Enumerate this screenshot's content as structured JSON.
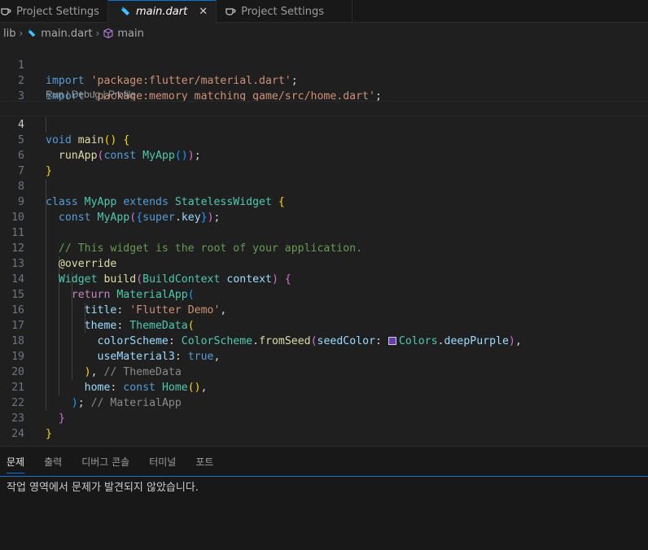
{
  "tabs": [
    {
      "label": "Project Settings",
      "active": false,
      "icon": "cup-icon"
    },
    {
      "label": "main.dart",
      "active": true,
      "icon": "dart-icon",
      "close": "✕"
    },
    {
      "label": "Project Settings",
      "active": false,
      "icon": "cup-icon"
    }
  ],
  "breadcrumb": {
    "folder": "lib",
    "file": "main.dart",
    "symbol": "main"
  },
  "codelens": "Run | Debug | Profile",
  "lines": {
    "n1": "1",
    "n2": "2",
    "n3": "3",
    "n4": "4",
    "n5": "5",
    "n6": "6",
    "n7": "7",
    "n8": "8",
    "n9": "9",
    "n10": "10",
    "n11": "11",
    "n12": "12",
    "n13": "13",
    "n14": "14",
    "n15": "15",
    "n16": "16",
    "n17": "17",
    "n18": "18",
    "n19": "19",
    "n20": "20",
    "n21": "21",
    "n22": "22",
    "n23": "23",
    "n24": "24"
  },
  "code": {
    "import": "import",
    "pkg_material": "'package:flutter/material.dart'",
    "pkg_home": "'package:memory_matching_game/src/home.dart'",
    "semi": ";",
    "void": "void",
    "main": "main",
    "runApp": "runApp",
    "const": "const",
    "MyApp": "MyApp",
    "class": "class",
    "extends": "extends",
    "StatelessWidget": "StatelessWidget",
    "super": "super",
    "key": "key",
    "comment_root": "// This widget is the root of your application.",
    "override": "@override",
    "Widget": "Widget",
    "build": "build",
    "BuildContext": "BuildContext",
    "context": "context",
    "return": "return",
    "MaterialApp": "MaterialApp",
    "title": "title",
    "title_value": "'Flutter Demo'",
    "theme": "theme",
    "ThemeData": "ThemeData",
    "colorScheme": "colorScheme",
    "ColorScheme": "ColorScheme",
    "fromSeed": "fromSeed",
    "seedColor": "seedColor",
    "Colors": "Colors",
    "deepPurple": "deepPurple",
    "useMaterial3": "useMaterial3",
    "true": "true",
    "comment_themedata": "// ThemeData",
    "home": "home",
    "Home": "Home",
    "comment_materialapp": "// MaterialApp"
  },
  "swatch_color": "#673ab7",
  "panel": {
    "tabs": [
      "문제",
      "출력",
      "디버그 콘솔",
      "터미널",
      "포트"
    ],
    "message": "작업 영역에서 문제가 발견되지 않았습니다."
  }
}
